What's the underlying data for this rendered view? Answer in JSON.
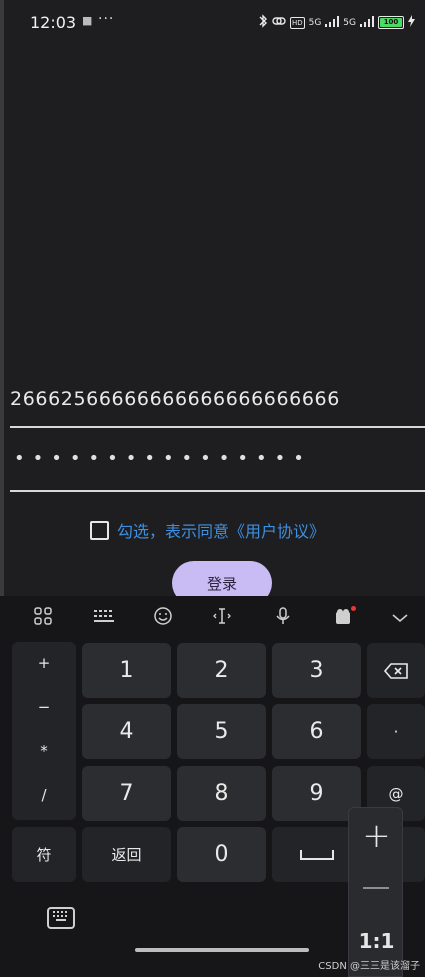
{
  "status_bar": {
    "time": "12:03",
    "notification": "■",
    "more": "···",
    "hd": "HD",
    "signal1": "5G",
    "signal2": "5G",
    "battery": "100",
    "bluetooth_icon": "bluetooth-icon",
    "charging_icon": "charging-icon"
  },
  "form": {
    "account_value": "26662566666666666666666666",
    "password_mask": "••••••••••••••••",
    "agree_text": "勾选，表示同意《用户协议》",
    "login_label": "登录"
  },
  "keyboard": {
    "toolbar_icons": [
      "apps-grid-icon",
      "keyboard-icon",
      "emoji-icon",
      "cursor-icon",
      "mic-icon",
      "clipboard-icon",
      "collapse-chevron-icon"
    ],
    "symbols": [
      "+",
      "−",
      "*",
      "/"
    ],
    "digits": [
      "1",
      "2",
      "3",
      "4",
      "5",
      "6",
      "7",
      "8",
      "9",
      "0"
    ],
    "side_keys": [
      "⌫",
      "·",
      "@"
    ],
    "sym_label": "符",
    "back_label": "返回",
    "zero": "0"
  },
  "zoom": {
    "zoom_in": "+",
    "ratio": "1:1"
  },
  "watermark": "CSDN @三三是该溜子"
}
